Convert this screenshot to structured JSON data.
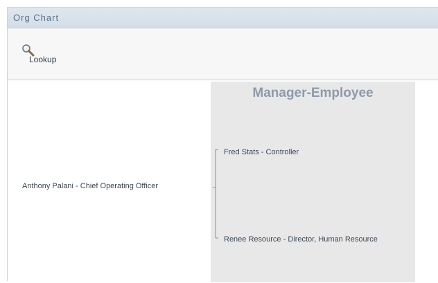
{
  "window": {
    "title": "Org Chart"
  },
  "toolbar": {
    "lookup_label": "Lookup",
    "lookup_icon": "magnifier-icon"
  },
  "panel": {
    "title": "Manager-Employee"
  },
  "org": {
    "manager": "Anthony Palani - Chief Operating Officer",
    "employees": [
      "Fred Stats - Controller",
      "Renee Resource - Director, Human Resource"
    ]
  },
  "colors": {
    "titlebar_bg": "#d8e1ea",
    "title_text": "#5a7085",
    "panel_bg": "#e8e8e8",
    "panel_title": "#8e9aaa"
  }
}
